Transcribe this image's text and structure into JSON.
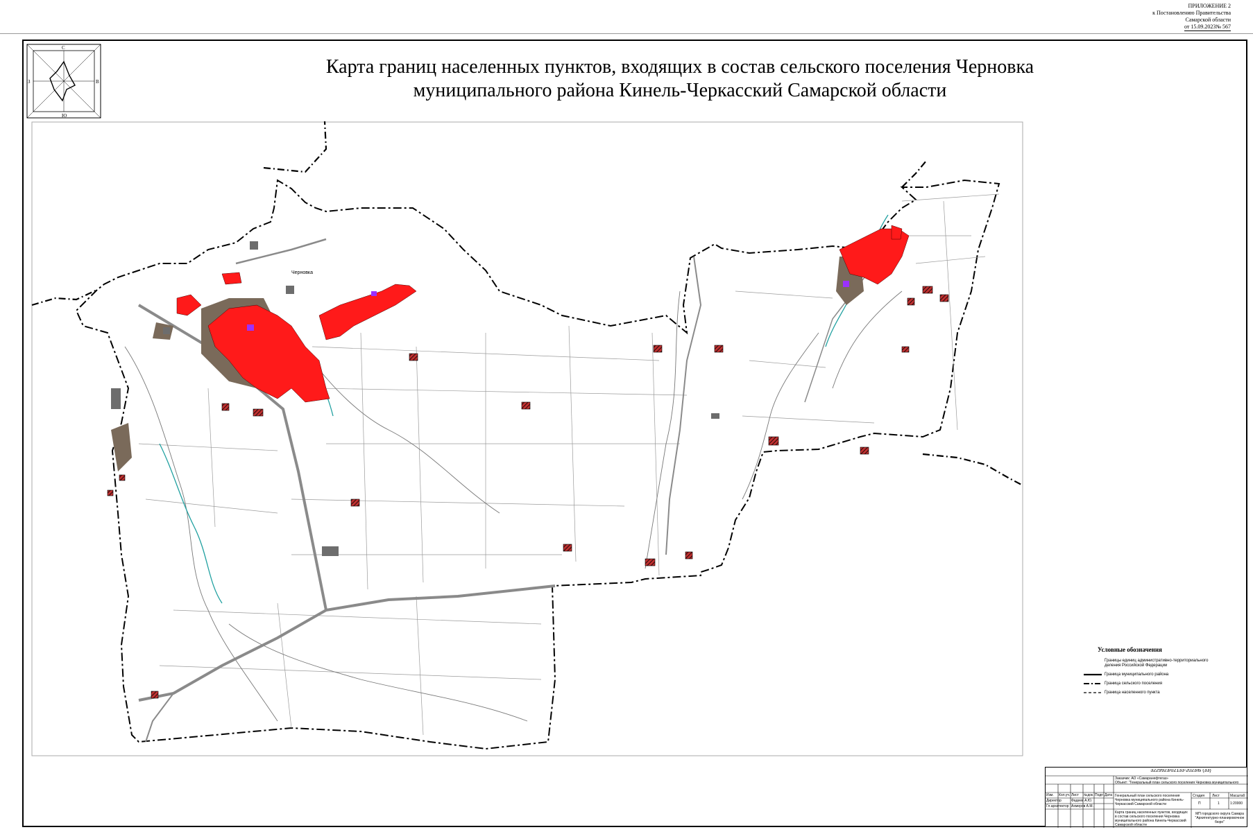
{
  "appendix": {
    "line1": "ПРИЛОЖЕНИЕ 2",
    "line2": "к Постановлению Правительства",
    "line3": "Самарской области",
    "line4": "от 15.09.2023№ 567"
  },
  "title": {
    "line1": "Карта границ населенных пунктов, входящих в состав сельского поселения Черновка",
    "line2": "муниципального района Кинель-Черкасский Самарской области"
  },
  "compass": {
    "north": "С",
    "south": "Ю",
    "west": "З",
    "east": "В"
  },
  "map": {
    "settlement_label": "Черновка",
    "colors": {
      "settlement_fill": "#ff1a1a",
      "forest_fill": "#7a6a5a",
      "boundary": "#000000",
      "road": "#888888",
      "water": "#20a0a0",
      "highlight": "#9b30ff"
    }
  },
  "legend": {
    "title": "Условные обозначения",
    "items": [
      "Границы единиц административно-территориального деления Российской Федерации",
      "Граница муниципального района",
      "Граница сельского поселения",
      "Граница населенного пункта"
    ]
  },
  "stamp": {
    "doc_code": "3229923/02133-2023/Б (33)",
    "customer": "Заказчик: АО «Самаранефтегаз»",
    "object": "Объект: \"Генеральный план сельского поселения Черновка муниципального района Кинель-Черкасский Самарской области\"",
    "header_cols": [
      "Изм.",
      "Кол.уч.",
      "Лист",
      "№док.",
      "Подп.",
      "Дата"
    ],
    "role1": "Директор",
    "name1": "Фадеев А.Ю.",
    "role2": "Гл.архитектор",
    "name2": "Ахмеров А.М.",
    "section": "Генеральный план сельского поселения Черновка муниципального района Кинель-Черкасский Самарской области",
    "sheet_title": "Карта границ населенных пунктов, входящих в состав сельского поселения Черновка муниципального района Кинель-Черкасский Самарской области",
    "stage_label": "Стадия",
    "sheet_label": "Лист",
    "scale_label": "Масштаб",
    "stage": "П",
    "sheet": "1",
    "scale": "1:20000",
    "organization": "МП городского округа Самара \"Архитектурно-планировочное бюро\""
  }
}
